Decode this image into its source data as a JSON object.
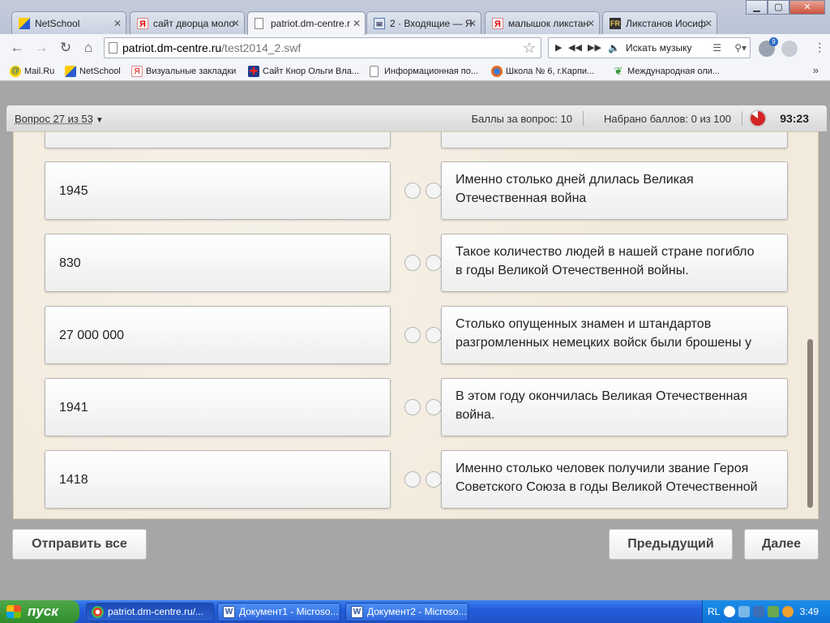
{
  "browser": {
    "tabs": [
      {
        "label": "NetSchool",
        "icon": "netschool-icon",
        "active": false
      },
      {
        "label": "сайт дворца моло",
        "icon": "yandex-icon",
        "active": false
      },
      {
        "label": "patriot.dm-centre.r",
        "icon": "page-icon",
        "active": true
      },
      {
        "label": "2 · Входящие — Я",
        "icon": "mail-icon",
        "active": false
      },
      {
        "label": "малышок ликстан",
        "icon": "yandex-icon",
        "active": false
      },
      {
        "label": "Ликстанов Иосиф",
        "icon": "fr-icon",
        "active": false
      }
    ],
    "address": {
      "host": "patriot.dm-centre.ru",
      "path": "/test2014_2.swf"
    },
    "music_search": "Искать музыку",
    "extension_badge": "9",
    "bookmarks": [
      {
        "label": "Mail.Ru",
        "icon": "mailru-icon"
      },
      {
        "label": "NetSchool",
        "icon": "netschool-icon"
      },
      {
        "label": "Визуальные закладки",
        "icon": "yandex-icon"
      },
      {
        "label": "Сайт Кнор Ольги Вла...",
        "icon": "uk-flag-icon"
      },
      {
        "label": "Информационная по...",
        "icon": "page-icon"
      },
      {
        "label": "Школа № 6, г.Карпи...",
        "icon": "firefox-icon"
      },
      {
        "label": "Международная оли...",
        "icon": "leaf-icon"
      }
    ],
    "bookmarks_more": "»"
  },
  "quiz": {
    "question_label": "Вопрос 27 из 53",
    "points_per_question": "Баллы за вопрос: 10",
    "total_scored": "Набрано баллов: 0 из 100",
    "timer": "93:23",
    "pairs": [
      {
        "left": "1945",
        "right": [
          "Именно столько дней длилась Великая",
          "Отечественная война"
        ]
      },
      {
        "left": "830",
        "right": [
          "Такое количество людей в нашей стране погибло",
          "в годы Великой Отечественной войны."
        ]
      },
      {
        "left": "27 000 000",
        "right": [
          "Столько опущенных знамен и штандартов",
          "разгромленных немецких войск были брошены у"
        ]
      },
      {
        "left": "1941",
        "right": [
          "В этом году окончилась Великая Отечественная",
          "война."
        ]
      },
      {
        "left": "1418",
        "right": [
          "Именно столько человек получили звание Героя",
          "Советского Союза в годы Великой Отечественной"
        ]
      }
    ],
    "buttons": {
      "submit_all": "Отправить все",
      "previous": "Предыдущий",
      "next": "Далее"
    }
  },
  "taskbar": {
    "start_label": "пуск",
    "tasks": [
      {
        "label": "patriot.dm-centre.ru/...",
        "active": true
      },
      {
        "label": "Документ1 - Microso...",
        "active": false
      },
      {
        "label": "Документ2 - Microso...",
        "active": false
      }
    ],
    "language": "RL",
    "clock": "3:49"
  }
}
